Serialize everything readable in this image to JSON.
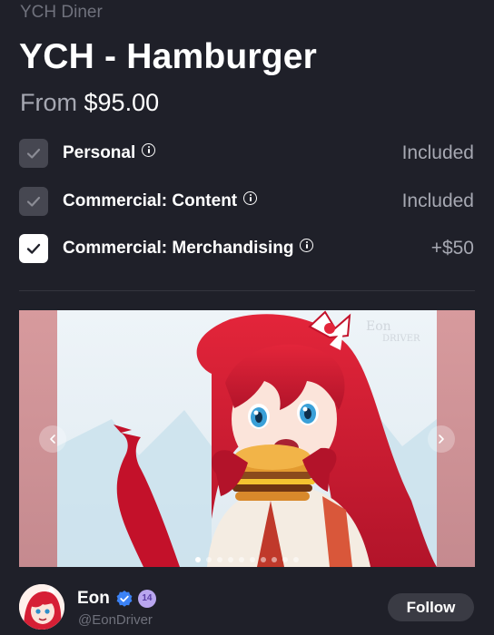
{
  "shop": {
    "name": "YCH Diner"
  },
  "product": {
    "title": "YCH - Hamburger",
    "price_prefix": "From",
    "price": "$95.00"
  },
  "licenses": [
    {
      "label": "Personal",
      "status": "Included",
      "checked": true,
      "disabled": true,
      "icon": "info-icon"
    },
    {
      "label": "Commercial: Content",
      "status": "Included",
      "checked": true,
      "disabled": true,
      "icon": "info-icon"
    },
    {
      "label": "Commercial: Merchandising",
      "status": "+$50",
      "checked": true,
      "disabled": false,
      "icon": "info-icon"
    }
  ],
  "gallery": {
    "watermark": "EonDriver",
    "prev_icon": "chevron-left-icon",
    "next_icon": "chevron-right-icon",
    "slide_count": 10,
    "active_slide": 1
  },
  "artist": {
    "name": "Eon",
    "handle": "@EonDriver",
    "level_badge": "14",
    "verified_icon": "verified-check-icon",
    "follow_label": "Follow"
  },
  "colors": {
    "background": "#1f2029",
    "muted_text": "#6f717c",
    "secondary_text": "#a6a8b2",
    "disabled_checkbox": "#464751",
    "verified_blue": "#3b82f6",
    "level_badge": "#b9a6ef",
    "follow_button_bg": "#3a3b44"
  }
}
